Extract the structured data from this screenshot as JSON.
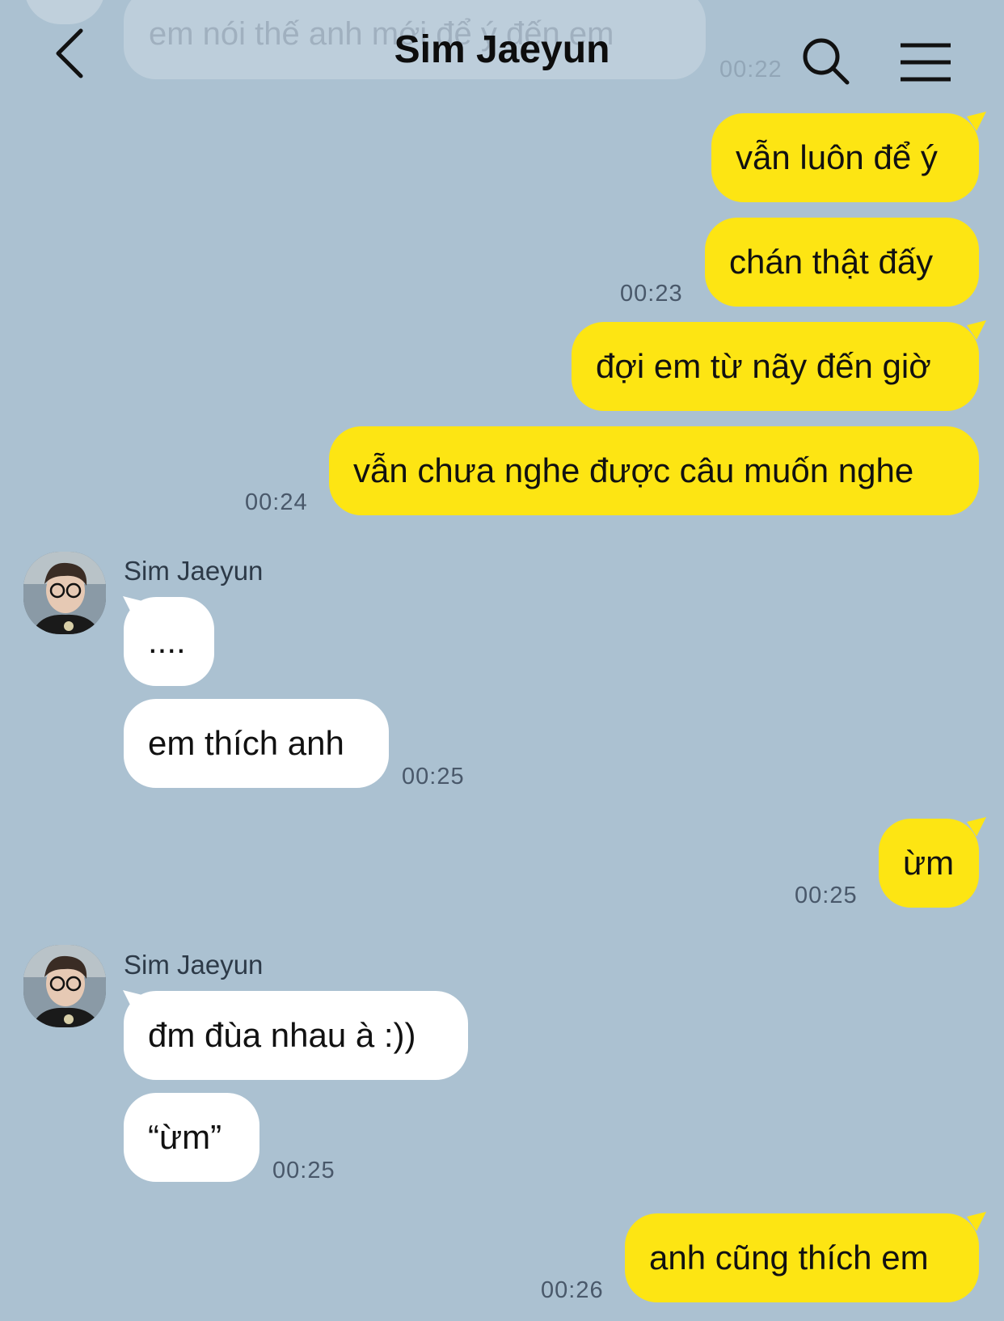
{
  "header": {
    "title": "Sim Jaeyun",
    "previous_message_text": "em nói thế anh mới để ý đến em",
    "previous_message_time": "00:22"
  },
  "messages": [
    {
      "side": "me",
      "text": "vẫn luôn để ý"
    },
    {
      "side": "me",
      "text": "chán thật đấy",
      "time": "00:23"
    },
    {
      "side": "me",
      "text": "đợi em từ nãy đến giờ"
    },
    {
      "side": "me",
      "text": "vẫn chưa nghe được câu muốn nghe",
      "time": "00:24"
    },
    {
      "side": "them",
      "sender": "Sim Jaeyun",
      "text": "...."
    },
    {
      "side": "them",
      "text": "em thích anh",
      "time": "00:25"
    },
    {
      "side": "me",
      "text": "ừm",
      "time": "00:25"
    },
    {
      "side": "them",
      "sender": "Sim Jaeyun",
      "text": "đm đùa nhau à :))"
    },
    {
      "side": "them",
      "text": "“ừm”",
      "time": "00:25"
    },
    {
      "side": "me",
      "text": "anh cũng thích em",
      "time": "00:26"
    }
  ],
  "colors": {
    "background": "#abc1d1",
    "my_bubble": "#fde513",
    "their_bubble": "#ffffff"
  },
  "icons": [
    "back-arrow-icon",
    "search-icon",
    "menu-icon"
  ]
}
